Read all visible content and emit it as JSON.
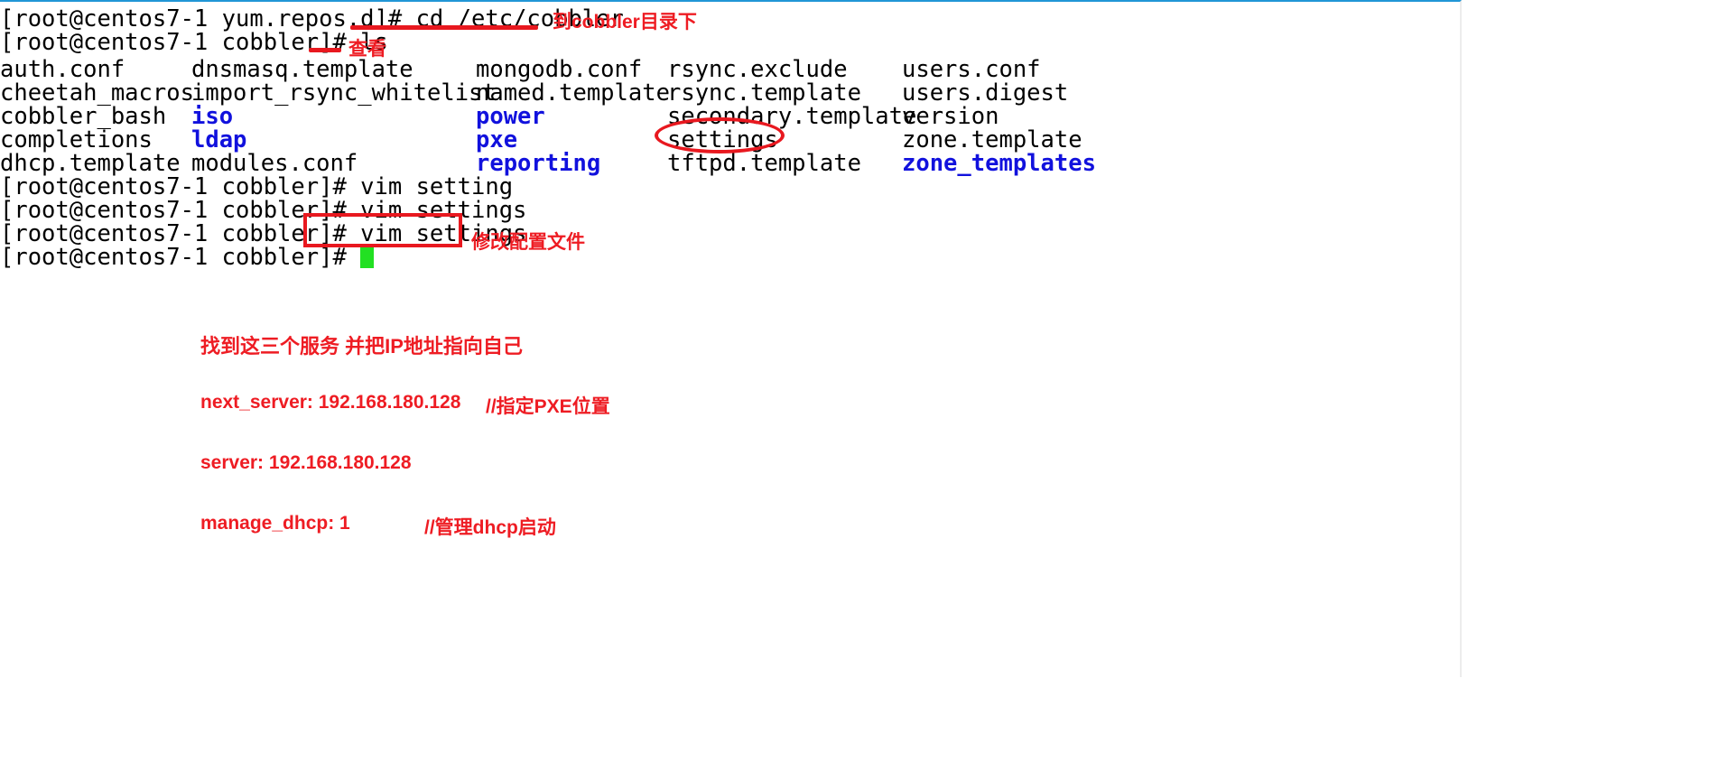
{
  "window": {
    "top_accent_color": "#2196d6",
    "right_border_color": "#ececec",
    "background": "#ffffff",
    "annotation_color": "#ee1c23",
    "directory_color": "#1111dd",
    "cursor_color": "#22e022"
  },
  "terminal": {
    "lines": [
      {
        "id": "cmd-cd",
        "prompt": "[root@centos7-1 yum.repos.d]# ",
        "command": "cd /etc/cobbler"
      },
      {
        "id": "cmd-ls",
        "prompt": "[root@centos7-1 cobbler]# ",
        "command": "ls"
      }
    ],
    "ls_output": {
      "columns": [
        [
          "auth.conf",
          "cheetah_macros",
          "cobbler_bash",
          "completions",
          "dhcp.template"
        ],
        [
          "dnsmasq.template",
          "import_rsync_whitelist",
          "iso",
          "ldap",
          "modules.conf"
        ],
        [
          "mongodb.conf",
          "named.template",
          "power",
          "pxe",
          "reporting"
        ],
        [
          "rsync.exclude",
          "rsync.template",
          "secondary.template",
          "settings",
          "tftpd.template"
        ],
        [
          "users.conf",
          "users.digest",
          "version",
          "zone.template",
          "zone_templates"
        ]
      ],
      "directories": [
        "iso",
        "ldap",
        "power",
        "pxe",
        "reporting",
        "zone_templates"
      ]
    },
    "after_lines": [
      {
        "id": "cmd-vim-setting",
        "prompt": "[root@centos7-1 cobbler]# ",
        "command": "vim setting"
      },
      {
        "id": "cmd-vim-settings-1",
        "prompt": "[root@centos7-1 cobbler]# ",
        "command": "vim settings"
      },
      {
        "id": "cmd-vim-settings-2",
        "prompt": "[root@centos7-1 cobbler]# ",
        "command": "vim settings"
      },
      {
        "id": "prompt-idle",
        "prompt": "[root@centos7-1 cobbler]# ",
        "command": ""
      }
    ]
  },
  "annotations": {
    "cd_label": "到cobbler目录下",
    "ls_label": "查看",
    "vim_settings_label": "修改配置文件",
    "instruction": "找到这三个服务 并把IP地址指向自己",
    "settings_entries": [
      {
        "id": "next-server",
        "setting": "next_server: 192.168.180.128",
        "comment": "//指定PXE位置"
      },
      {
        "id": "server",
        "setting": "server: 192.168.180.128",
        "comment": ""
      },
      {
        "id": "manage-dhcp",
        "setting": "manage_dhcp: 1",
        "comment": "//管理dhcp启动"
      }
    ]
  }
}
